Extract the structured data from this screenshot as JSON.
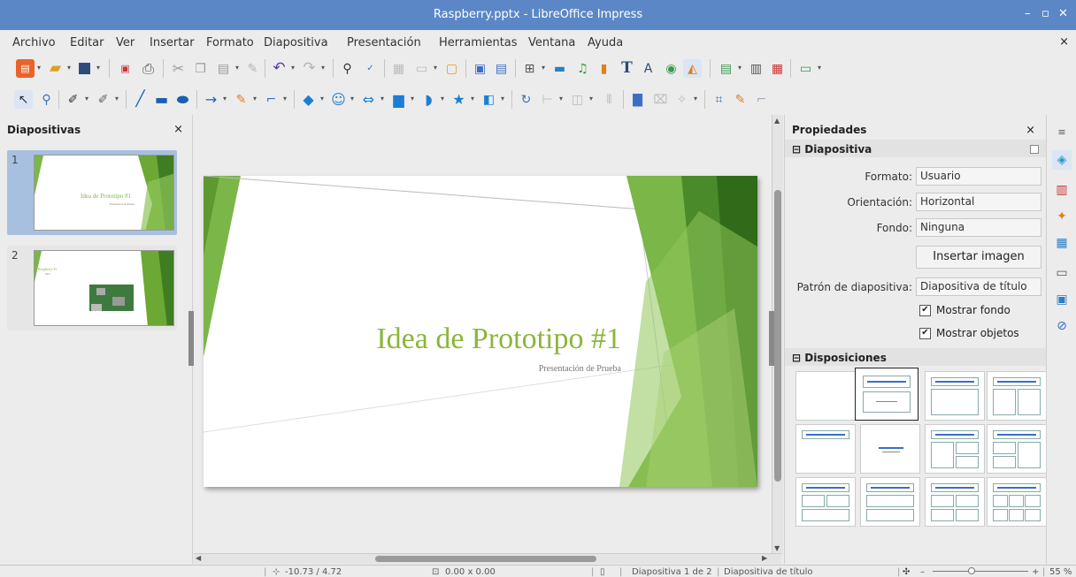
{
  "titlebar": {
    "title": "Raspberry.pptx - LibreOffice Impress",
    "minimize": "–",
    "maximize": "▫",
    "close": "✕"
  },
  "menubar": {
    "items": [
      "Archivo",
      "Editar",
      "Ver",
      "Insertar",
      "Formato",
      "Diapositiva",
      "Presentación",
      "Herramientas",
      "Ventana",
      "Ayuda"
    ],
    "close": "×"
  },
  "leftpanel": {
    "title": "Diapositivas",
    "close": "×",
    "slides": [
      {
        "number": "1",
        "title": "Idea de Prototipo #1",
        "subtitle": "Presentación de Prueba"
      },
      {
        "number": "2",
        "title": "Raspberry Pi",
        "subtitle": "2017"
      }
    ]
  },
  "slide": {
    "title": "Idea de Prototipo #1",
    "subtitle": "Presentación de Prueba"
  },
  "properties": {
    "title": "Propiedades",
    "close": "×",
    "section_slide": "Diapositiva",
    "format_label": "Formato:",
    "format_value": "Usuario",
    "orientation_label": "Orientación:",
    "orientation_value": "Horizontal",
    "background_label": "Fondo:",
    "background_value": "Ninguna",
    "insert_image": "Insertar imagen",
    "master_label": "Patrón de diapositiva:",
    "master_value": "Diapositiva de título",
    "show_background": "Mostrar fondo",
    "show_objects": "Mostrar objetos",
    "section_layouts": "Disposiciones"
  },
  "statusbar": {
    "position": "-10.73 / 4.72",
    "size": "0.00 x 0.00",
    "slide": "Diapositiva 1 de 2",
    "master": "Diapositiva de título",
    "zoom_minus": "–",
    "zoom_plus": "+",
    "zoom": "55 %"
  },
  "colors": {
    "titlebar": "#5b87c7",
    "accent_green": "#7ab648",
    "dark_green": "#4a8a2a",
    "title_green": "#8bb63a"
  }
}
